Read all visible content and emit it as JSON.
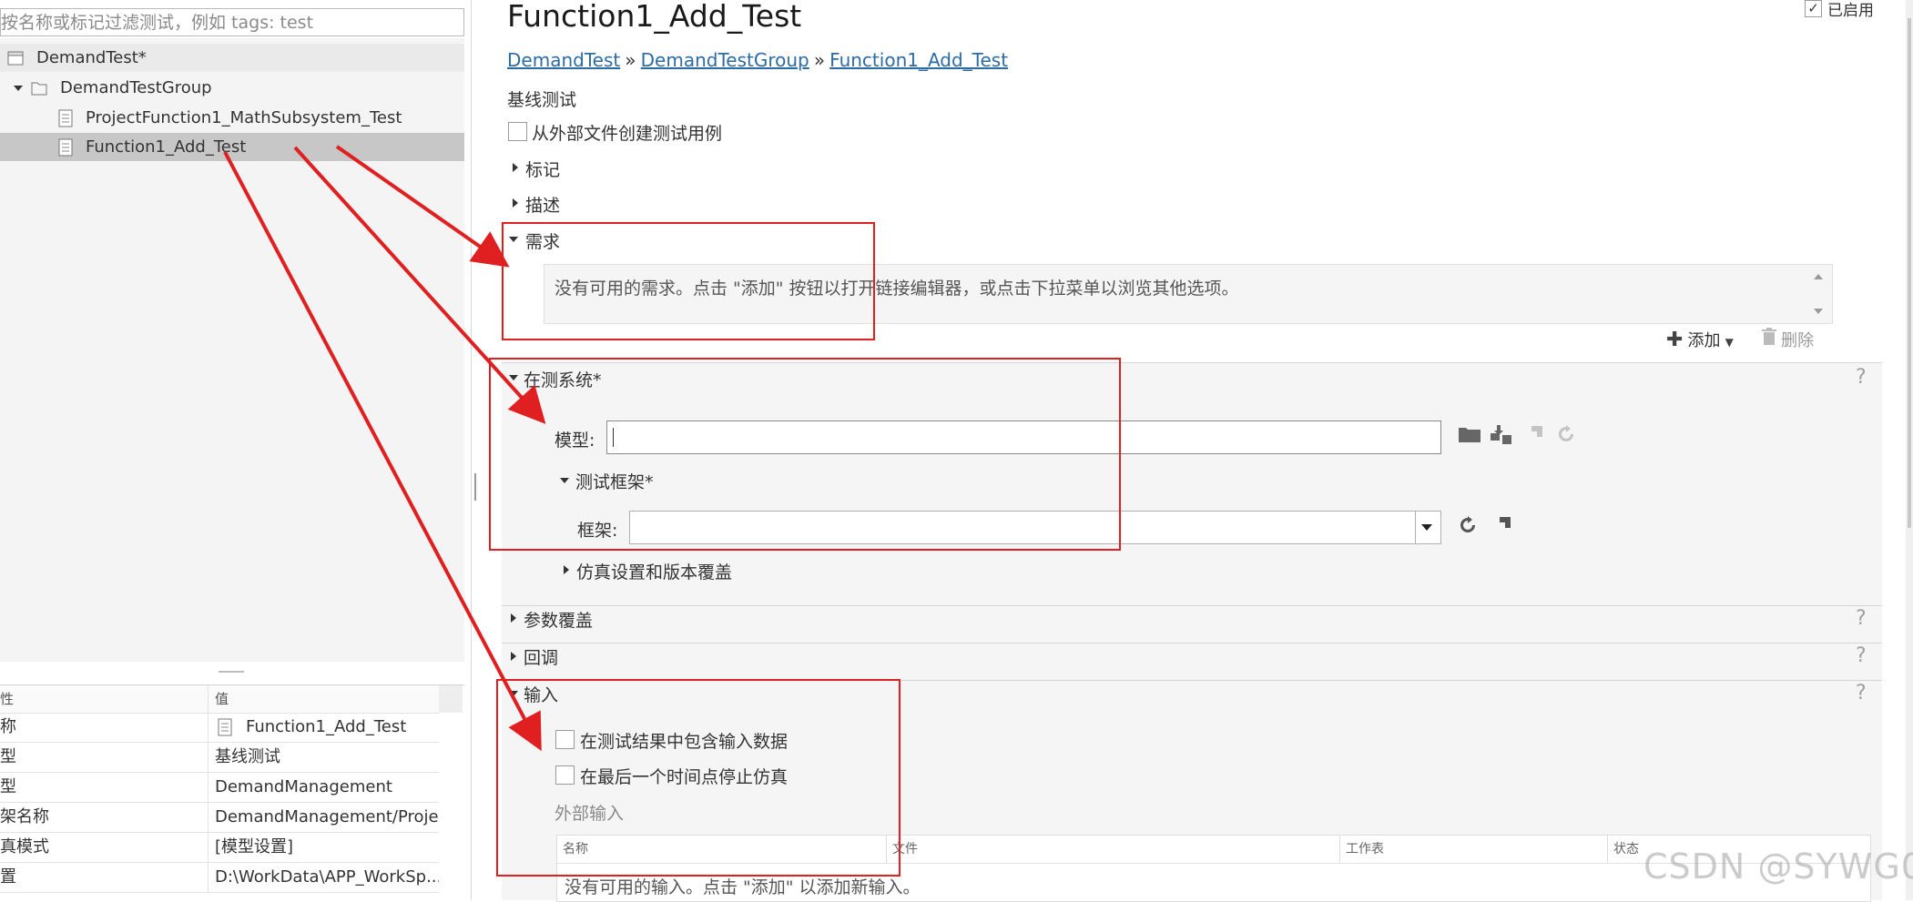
{
  "filter": {
    "placeholder": "按名称或标记过滤测试，例如 tags: test"
  },
  "tree": {
    "items": [
      {
        "label": "DemandTest*"
      },
      {
        "label": "DemandTestGroup"
      },
      {
        "label": "ProjectFunction1_MathSubsystem_Test"
      },
      {
        "label": "Function1_Add_Test"
      }
    ]
  },
  "properties": {
    "headers": [
      "性",
      "值"
    ],
    "rows": [
      {
        "key": "称",
        "value": "Function1_Add_Test"
      },
      {
        "key": "型",
        "value": "基线测试"
      },
      {
        "key": "型",
        "value": "DemandManagement"
      },
      {
        "key": "架名称",
        "value": "DemandManagement/Proje..."
      },
      {
        "key": "真模式",
        "value": "[模型设置]"
      },
      {
        "key": "置",
        "value": "D:\\WorkData\\APP_WorkSp..."
      }
    ]
  },
  "main": {
    "title": "Function1_Add_Test",
    "enabled_label": "已启用",
    "enabled_check": "✓",
    "breadcrumb": [
      "DemandTest",
      "DemandTestGroup",
      "Function1_Add_Test"
    ],
    "breadcrumb_sep": "»",
    "test_type": "基线测试",
    "create_from_file": "从外部文件创建测试用例",
    "sections": {
      "tags": "标记",
      "description": "描述",
      "requirements": "需求",
      "system_under_test": "在测系统*",
      "parameter_overrides": "参数覆盖",
      "callbacks": "回调",
      "inputs": "输入"
    },
    "requirements_empty": "没有可用的需求。点击 \"添加\" 按钮以打开链接编辑器，或点击下拉菜单以浏览其他选项。",
    "add_label": "添加",
    "delete_label": "删除",
    "model_label": "模型:",
    "model_value": "",
    "harness_section": "测试框架*",
    "harness_label": "框架:",
    "harness_value": "",
    "sim_settings": "仿真设置和版本覆盖",
    "include_input": "在测试结果中包含输入数据",
    "stop_sim": "在最后一个时间点停止仿真",
    "external_inputs": "外部输入",
    "input_table_headers": [
      "名称",
      "文件",
      "工作表",
      "状态"
    ],
    "inputs_empty": "没有可用的输入。点击 \"添加\" 以添加新输入。",
    "help": "?"
  },
  "watermark": "CSDN @SYWG0",
  "colors": {
    "annotation_red": "#e02020",
    "selection": "#c7c7c7",
    "link": "#2d6ca2"
  }
}
